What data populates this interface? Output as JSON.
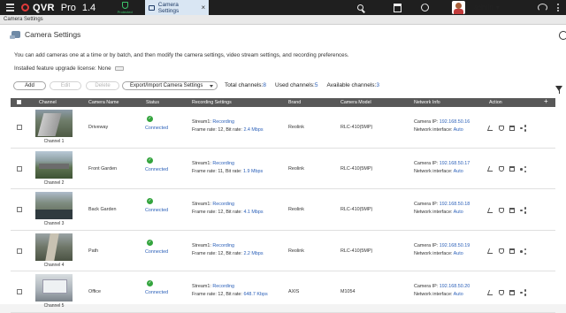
{
  "app": {
    "name": "QVR",
    "product": "Pro",
    "version": "1.4",
    "protection_status": "Protected"
  },
  "tab": {
    "label": "Camera Settings"
  },
  "user": {
    "name": "admin"
  },
  "window": {
    "title": "Camera Settings"
  },
  "page": {
    "title": "Camera Settings",
    "description": "You can add cameras one at a time or by batch, and then modify the camera settings, video stream settings, and recording preferences.",
    "license": "Installed feature upgrade license: None"
  },
  "toolbar": {
    "add": "Add",
    "edit": "Edit",
    "delete": "Delete",
    "export_import": "Export/Import Camera Settings",
    "total_label": "Total channels:",
    "total": "8",
    "used_label": "Used channels:",
    "used": "5",
    "available_label": "Available channels:",
    "available": "3"
  },
  "columns": [
    "Channel",
    "Camera Name",
    "Status",
    "Recording Settings",
    "Brand",
    "Camera Model",
    "Network Info",
    "Action"
  ],
  "add_column_symbol": "+",
  "labels": {
    "stream": "Stream1: ",
    "frame_rate": "Frame rate: ",
    "bit_rate": ", Bit rate: ",
    "camera_ip": "Camera IP: ",
    "network_interface": "Network interface: "
  },
  "cameras": [
    {
      "channel": "Channel 1",
      "name": "Driveway",
      "status": "Connected",
      "recording": "Recording",
      "frame_rate": "12",
      "bit_rate": "2.4 Mbps",
      "brand": "Reolink",
      "model": "RLC-410(5MP)",
      "ip": "192.168.50.16",
      "interface": "Auto"
    },
    {
      "channel": "Channel 2",
      "name": "Front Garden",
      "status": "Connected",
      "recording": "Recording",
      "frame_rate": "11",
      "bit_rate": "1.9 Mbps",
      "brand": "Reolink",
      "model": "RLC-410(5MP)",
      "ip": "192.168.50.17",
      "interface": "Auto"
    },
    {
      "channel": "Channel 3",
      "name": "Back Garden",
      "status": "Connected",
      "recording": "Recording",
      "frame_rate": "12",
      "bit_rate": "4.1 Mbps",
      "brand": "Reolink",
      "model": "RLC-410(5MP)",
      "ip": "192.168.50.18",
      "interface": "Auto"
    },
    {
      "channel": "Channel 4",
      "name": "Path",
      "status": "Connected",
      "recording": "Recording",
      "frame_rate": "12",
      "bit_rate": "2.2 Mbps",
      "brand": "Reolink",
      "model": "RLC-410(5MP)",
      "ip": "192.168.50.19",
      "interface": "Auto"
    },
    {
      "channel": "Channel 5",
      "name": "Office",
      "status": "Connected",
      "recording": "Recording",
      "frame_rate": "12",
      "bit_rate": "648.7 Kbps",
      "brand": "AXIS",
      "model": "M1054",
      "ip": "192.168.50.20",
      "interface": "Auto"
    }
  ],
  "colors": {
    "topbar": "#1f1f1f",
    "link_blue": "#2a5fb8",
    "ok_green": "#33a43d",
    "table_header": "#585858"
  }
}
